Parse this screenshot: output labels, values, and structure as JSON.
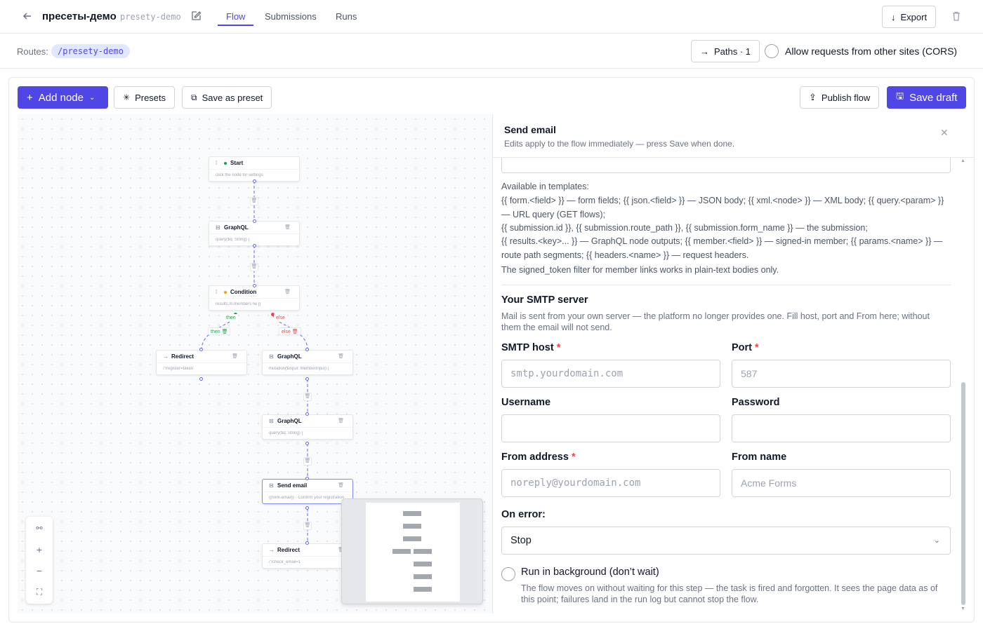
{
  "header": {
    "title": "пресеты-демо",
    "slug": "presety-demo",
    "tabs": [
      "Flow",
      "Submissions",
      "Runs"
    ],
    "export_label": "Export"
  },
  "routes": {
    "label": "Routes:",
    "route": "/presety-demo",
    "paths_label": "Paths · 1",
    "cors_label": "Allow requests from other sites (CORS)"
  },
  "toolbar": {
    "add_node": "Add node",
    "presets": "Presets",
    "save_as_preset": "Save as preset",
    "publish": "Publish flow",
    "save_draft": "Save draft"
  },
  "canvas": {
    "nodes": [
      {
        "title": "Start",
        "body": "click the node for settings"
      },
      {
        "title": "GraphQL",
        "body": "query($q: String) {"
      },
      {
        "title": "Condition",
        "body": "results.m.members ne []"
      },
      {
        "title": "Redirect",
        "body": "/?register=taken"
      },
      {
        "title": "GraphQL",
        "body": "mutation($input: MemberInput) {"
      },
      {
        "title": "GraphQL",
        "body": "query($q: String) {"
      },
      {
        "title": "Send email",
        "body": "{{form.email}} · Confirm your registration"
      },
      {
        "title": "Redirect",
        "body": "/?check_email=1"
      }
    ],
    "branch_then": "then",
    "branch_else": "else",
    "colors": {
      "accent": "#4f46e5",
      "then": "#16a34a",
      "else": "#ef4444",
      "edge": "#6366f1"
    }
  },
  "side": {
    "title": "Send email",
    "subtitle": "Edits apply to the flow immediately — press Save when done.",
    "help_lines": [
      "Available in templates:",
      "{{ form.<field> }} — form fields; {{ json.<field> }} — JSON body; {{ xml.<node> }} — XML body; {{ query.<param> }} — URL query (GET flows);",
      "{{ submission.id }}, {{ submission.route_path }}, {{ submission.form_name }} — the submission;",
      "{{ results.<key>... }} — GraphQL node outputs; {{ member.<field> }} — signed-in member; {{ params.<name> }} — route path segments; {{ headers.<name> }} — request headers.",
      "The signed_token filter for member links works in plain-text bodies only."
    ],
    "smtp_title": "Your SMTP server",
    "smtp_desc": "Mail is sent from your own server — the platform no longer provides one. Fill host, port and From here; without them the email will not send.",
    "fields": {
      "host_label": "SMTP host",
      "host_placeholder": "smtp.yourdomain.com",
      "port_label": "Port",
      "port_placeholder": "587",
      "username_label": "Username",
      "password_label": "Password",
      "from_label": "From address",
      "from_placeholder": "noreply@yourdomain.com",
      "from_name_label": "From name",
      "from_name_placeholder": "Acme Forms"
    },
    "on_error_label": "On error:",
    "on_error_value": "Stop",
    "background_label": "Run in background (don’t wait)",
    "background_desc": "The flow moves on without waiting for this step — the task is fired and forgotten. It sees the page data as of this point; failures land in the run log but cannot stop the flow."
  }
}
